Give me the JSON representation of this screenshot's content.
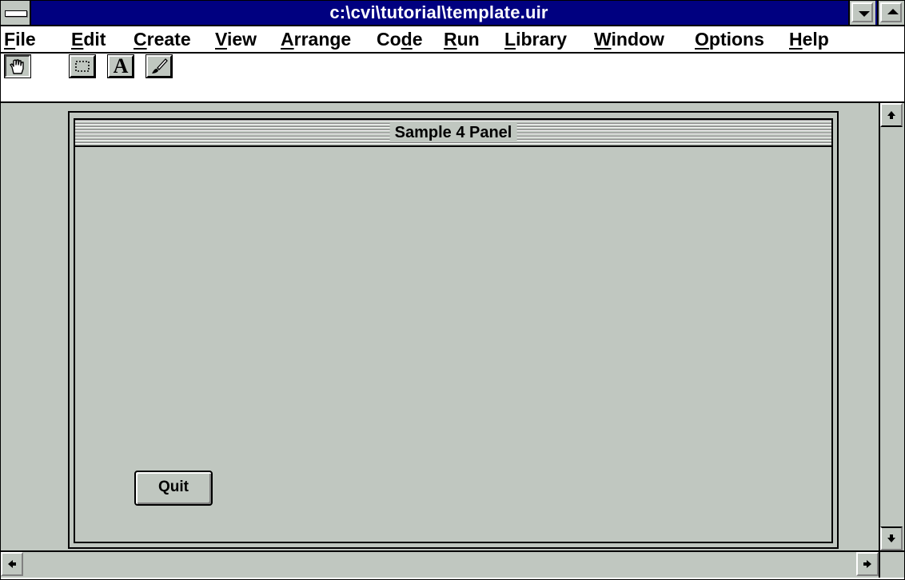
{
  "window": {
    "title": "c:\\cvi\\tutorial\\template.uir"
  },
  "menubar": {
    "items": [
      {
        "ul": "F",
        "rest": "ile"
      },
      {
        "ul": "E",
        "rest": "dit"
      },
      {
        "ul": "C",
        "rest": "reate"
      },
      {
        "ul": "V",
        "rest": "iew"
      },
      {
        "ul": "A",
        "rest": "rrange"
      },
      {
        "pre": "Co",
        "ul": "d",
        "rest": "e"
      },
      {
        "ul": "R",
        "rest": "un"
      },
      {
        "ul": "L",
        "rest": "ibrary"
      },
      {
        "ul": "W",
        "rest": "indow"
      },
      {
        "ul": "O",
        "rest": "ptions"
      },
      {
        "ul": "H",
        "rest": "elp"
      }
    ]
  },
  "toolbar": {
    "tools": [
      "hand-icon",
      "select-rect-icon",
      "text-tool-icon",
      "paintbrush-icon"
    ],
    "text_tool_glyph": "A"
  },
  "panel": {
    "title": "Sample 4 Panel",
    "quit_label": "Quit"
  },
  "colors": {
    "titlebar": "#000080",
    "face": "#c0c7c0",
    "shadow": "#808080"
  }
}
